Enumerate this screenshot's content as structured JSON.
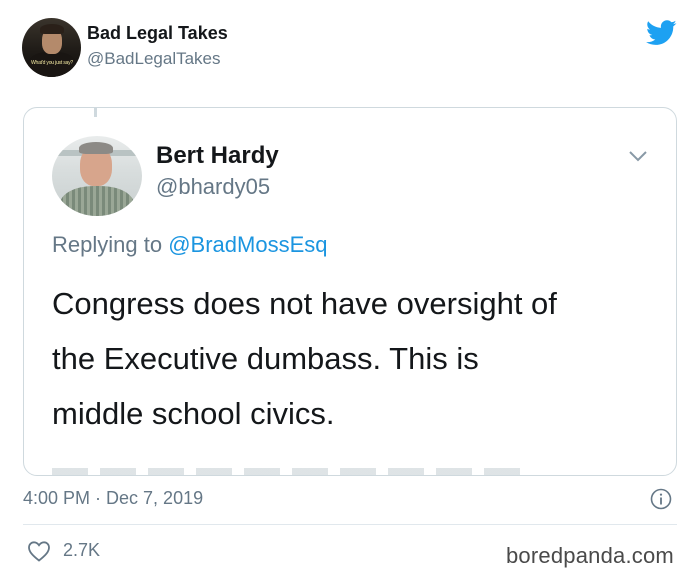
{
  "tweet": {
    "author_name": "Bad Legal Takes",
    "author_handle": "@BadLegalTakes",
    "avatar_caption": "What'd you just say?",
    "timestamp": "4:00 PM · Dec 7, 2019",
    "likes": "2.7K"
  },
  "quoted": {
    "name": "Bert Hardy",
    "handle": "@bhardy05",
    "replying_prefix": "Replying to",
    "replying_mention": "@BradMossEsq",
    "text_lines": [
      "Congress does not have oversight of",
      "the Executive dumbass. This is",
      "middle school civics."
    ]
  },
  "watermark": "boredpanda.com",
  "icons": {
    "brand": "twitter-bird-icon",
    "menu": "chevron-down-icon",
    "info": "info-icon",
    "like": "heart-icon"
  },
  "colors": {
    "twitter_blue": "#1da1f2",
    "mention_blue": "#1b95e0",
    "secondary_text": "#657786",
    "primary_text": "#14171a",
    "border": "#cfd9de"
  }
}
